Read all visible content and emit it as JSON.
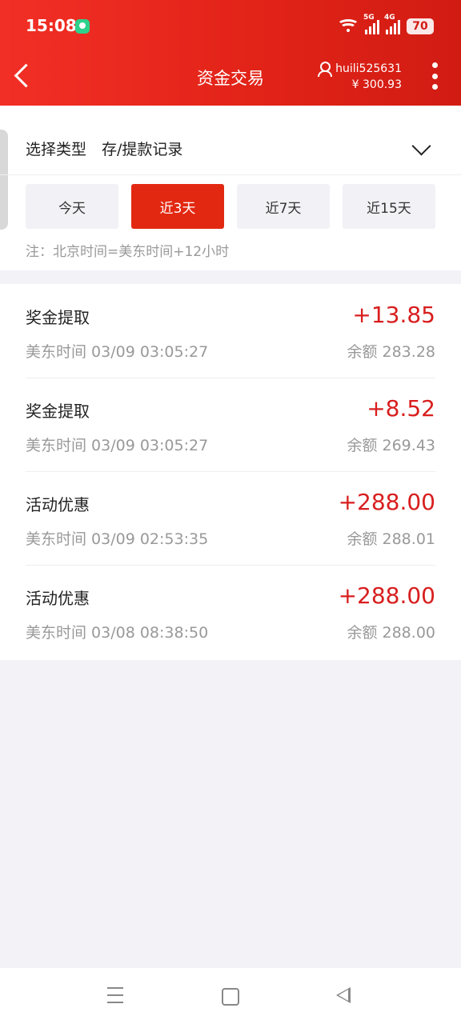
{
  "status_bar": {
    "time": "15:08",
    "net1": "5G",
    "net2": "4G",
    "battery": "70"
  },
  "header": {
    "title": "资金交易",
    "username": "huili525631",
    "balance": "¥ 300.93"
  },
  "filter": {
    "type_label": "选择类型",
    "type_value": "存/提款记录",
    "ranges": [
      {
        "label": "今天",
        "active": false
      },
      {
        "label": "近3天",
        "active": true
      },
      {
        "label": "近7天",
        "active": false
      },
      {
        "label": "近15天",
        "active": false
      }
    ],
    "note": "注：北京时间=美东时间+12小时"
  },
  "records": [
    {
      "name": "奖金提取",
      "amount": "+13.85",
      "time": "美东时间 03/09 03:05:27",
      "balance": "余额 283.28"
    },
    {
      "name": "奖金提取",
      "amount": "+8.52",
      "time": "美东时间 03/09 03:05:27",
      "balance": "余额 269.43"
    },
    {
      "name": "活动优惠",
      "amount": "+288.00",
      "time": "美东时间 03/09 02:53:35",
      "balance": "余额 288.01"
    },
    {
      "name": "活动优惠",
      "amount": "+288.00",
      "time": "美东时间 03/08 08:38:50",
      "balance": "余额 288.00"
    }
  ],
  "colors": {
    "brand_red": "#e22318",
    "amount_red": "#d81e1e"
  }
}
